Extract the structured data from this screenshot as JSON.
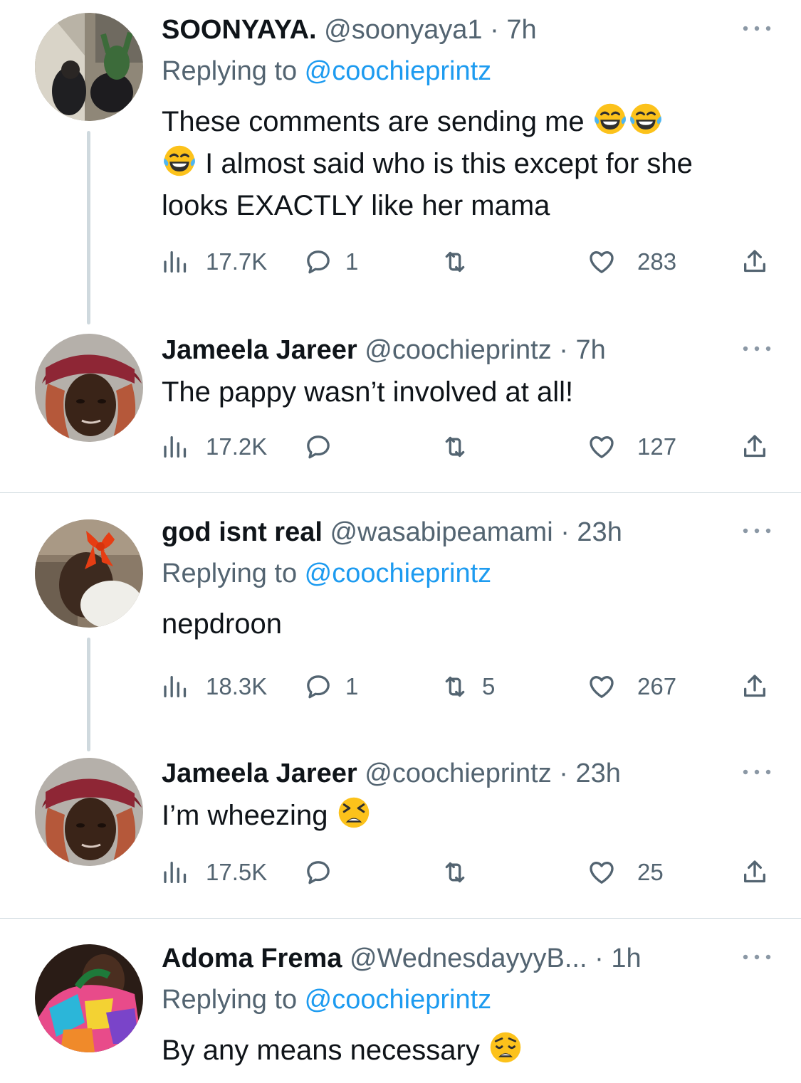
{
  "tweets": [
    {
      "name": "SOONYAYA.",
      "handle": "@soonyaya1",
      "dot": "·",
      "time": "7h",
      "replying_prefix": "Replying to ",
      "replying_to": "@coochieprintz",
      "text_line1": "These comments are sending me",
      "text_line2": "I almost said who is this except for she",
      "text_line3": "looks EXACTLY like her mama",
      "emojis": [
        "face-with-tears-of-joy",
        "face-with-tears-of-joy",
        "face-with-tears-of-joy"
      ],
      "views": "17.7K",
      "replies": "1",
      "retweets": "",
      "likes": "283"
    },
    {
      "name": "Jameela Jareer",
      "handle": "@coochieprintz",
      "dot": "·",
      "time": "7h",
      "text": "The pappy wasn’t involved at all!",
      "views": "17.2K",
      "replies": "",
      "retweets": "",
      "likes": "127"
    },
    {
      "name": "god isnt real",
      "handle": "@wasabipeamami",
      "dot": "·",
      "time": "23h",
      "replying_prefix": "Replying to ",
      "replying_to": "@coochieprintz",
      "text": "nepdroon",
      "views": "18.3K",
      "replies": "1",
      "retweets": "5",
      "likes": "267"
    },
    {
      "name": "Jameela Jareer",
      "handle": "@coochieprintz",
      "dot": "·",
      "time": "23h",
      "text": "I’m wheezing",
      "emojis": [
        "tired-face"
      ],
      "views": "17.5K",
      "replies": "",
      "retweets": "",
      "likes": "25"
    },
    {
      "name": "Adoma Frema",
      "handle": "@WednesdayyyB...",
      "dot": "·",
      "time": "1h",
      "replying_prefix": "Replying to ",
      "replying_to": "@coochieprintz",
      "text": "By any means necessary",
      "emojis": [
        "weary-face"
      ],
      "views": "",
      "replies": "",
      "retweets": "",
      "likes": ""
    }
  ],
  "colors": {
    "text": "#0f1419",
    "secondary": "#536471",
    "link": "#1d9bf0",
    "divider": "#cfd9de"
  },
  "icons": [
    "views-icon",
    "reply-icon",
    "retweet-icon",
    "like-icon",
    "share-icon",
    "more-icon"
  ]
}
